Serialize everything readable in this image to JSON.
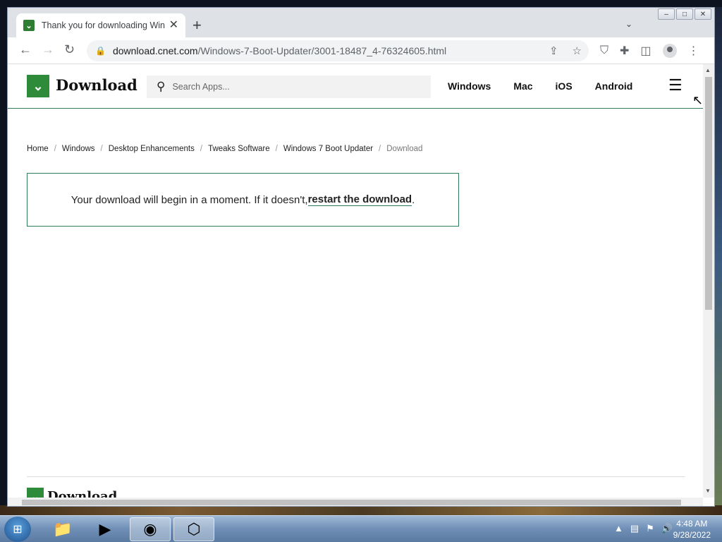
{
  "browser": {
    "tab_title": "Thank you for downloading Wind",
    "url_host": "download.cnet.com",
    "url_path": "/Windows-7-Boot-Updater/3001-18487_4-76324605.html"
  },
  "site": {
    "logo_text": "Download",
    "search_placeholder": "Search Apps...",
    "nav": [
      "Windows",
      "Mac",
      "iOS",
      "Android"
    ]
  },
  "breadcrumb": [
    "Home",
    "Windows",
    "Desktop Enhancements",
    "Tweaks Software",
    "Windows 7 Boot Updater"
  ],
  "breadcrumb_current": "Download",
  "notice": {
    "text": "Your download will begin in a moment. If it doesn't, ",
    "link": "restart the download",
    "suffix": "."
  },
  "footer": {
    "logo_text": "Download"
  },
  "taskbar": {
    "time": "4:48 AM",
    "date": "9/28/2022"
  },
  "colors": {
    "brand_green": "#2e8b3a",
    "border_green": "#2e7d5a"
  },
  "icons": {
    "back": "back-arrow-icon",
    "forward": "forward-arrow-icon",
    "reload": "reload-icon",
    "search": "search-icon",
    "menu": "hamburger-menu-icon"
  }
}
